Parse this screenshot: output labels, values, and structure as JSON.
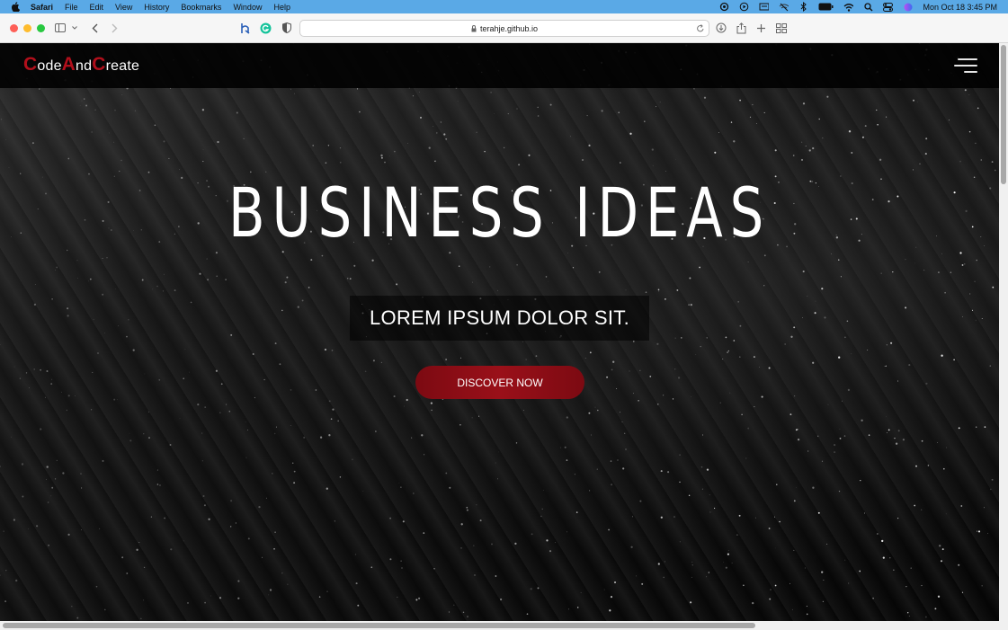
{
  "menubar": {
    "app_name": "Safari",
    "items": [
      "File",
      "Edit",
      "View",
      "History",
      "Bookmarks",
      "Window",
      "Help"
    ],
    "datetime": "Mon Oct 18  3:45 PM",
    "status_icons": [
      "focus-icon",
      "play-icon",
      "display-icon",
      "no-wifi-icon",
      "bluetooth-icon",
      "battery-icon",
      "wifi-icon",
      "spotlight-icon",
      "control-center-icon",
      "siri-icon"
    ]
  },
  "browser": {
    "url": "terahje.github.io"
  },
  "site": {
    "logo": [
      {
        "text": "C",
        "cap": true
      },
      {
        "text": "ode",
        "cap": false
      },
      {
        "text": "A",
        "cap": true
      },
      {
        "text": "nd",
        "cap": false
      },
      {
        "text": "C",
        "cap": true
      },
      {
        "text": "reate",
        "cap": false
      }
    ],
    "hero_title": "BUSINESS IDEAS",
    "hero_subtitle": "LOREM IPSUM DOLOR SIT.",
    "cta_label": "DISCOVER NOW"
  },
  "colors": {
    "accent": "#b10f1b",
    "cta": "#8f0e17",
    "menubar": "#5aa9e6"
  }
}
